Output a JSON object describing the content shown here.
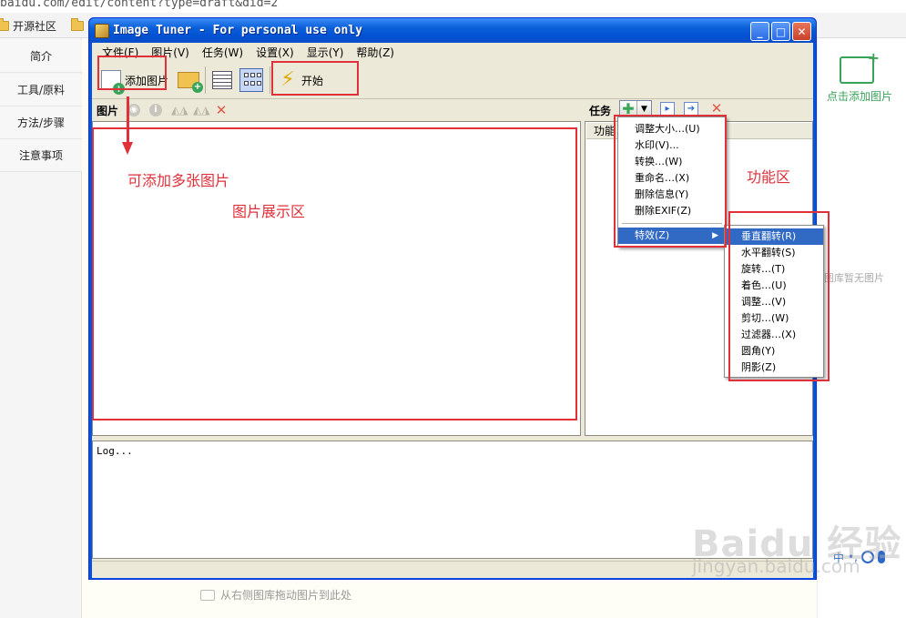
{
  "browser": {
    "url": "baidu.com/edit/content?type=draft&did=2",
    "bookmark": "开源社区"
  },
  "left_nav": {
    "items": [
      "简介",
      "工具/原料",
      "方法/步骤",
      "注意事项"
    ]
  },
  "page": {
    "add_picture": "点击添加图片",
    "no_pictures": "图库暂无图片",
    "drag_hint": "从右侧图库拖动图片到此处",
    "toolbar_text": "中"
  },
  "window": {
    "title": "Image Tuner - For personal use only",
    "menu": [
      "文件(F)",
      "图片(V)",
      "任务(W)",
      "设置(X)",
      "显示(Y)",
      "帮助(Z)"
    ],
    "toolbar": {
      "add_pictures": "添加图片",
      "start": "开始"
    },
    "pictures_label": "图片",
    "tasks_label": "任务",
    "task_column": "功能",
    "log": "Log..."
  },
  "task_menu": {
    "items": [
      "调整大小…(U)",
      "水印(V)...",
      "转换…(W)",
      "重命名…(X)",
      "删除信息(Y)",
      "删除EXIF(Z)"
    ],
    "effects": "特效(Z)"
  },
  "effects_menu": {
    "items": [
      "垂直翻转(R)",
      "水平翻转(S)",
      "旋转…(T)",
      "着色…(U)",
      "调整…(V)",
      "剪切…(W)",
      "过滤器…(X)",
      "圆角(Y)",
      "阴影(Z)"
    ],
    "selected_index": 0
  },
  "annotations": {
    "multi_add": "可添加多张图片",
    "display_area": "图片展示区",
    "function_area": "功能区"
  },
  "watermark": {
    "brand": "Baidu 经验",
    "sub": "jingyan.baidu.com"
  }
}
